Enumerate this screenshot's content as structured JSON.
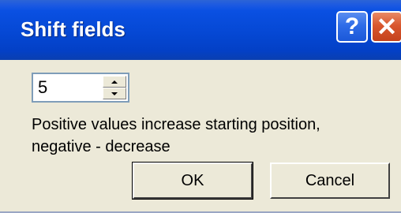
{
  "window": {
    "title": "Shift fields",
    "help_glyph": "?",
    "close_glyph": "✕"
  },
  "spin": {
    "value": "5"
  },
  "description": {
    "line1": "Positive values increase starting position,",
    "line2": "negative - decrease"
  },
  "buttons": {
    "ok_label": "OK",
    "cancel_label": "Cancel"
  },
  "colors": {
    "titlebar": "#0548d4",
    "dialog_bg": "#ece9d8",
    "close_button": "#d9572e"
  }
}
